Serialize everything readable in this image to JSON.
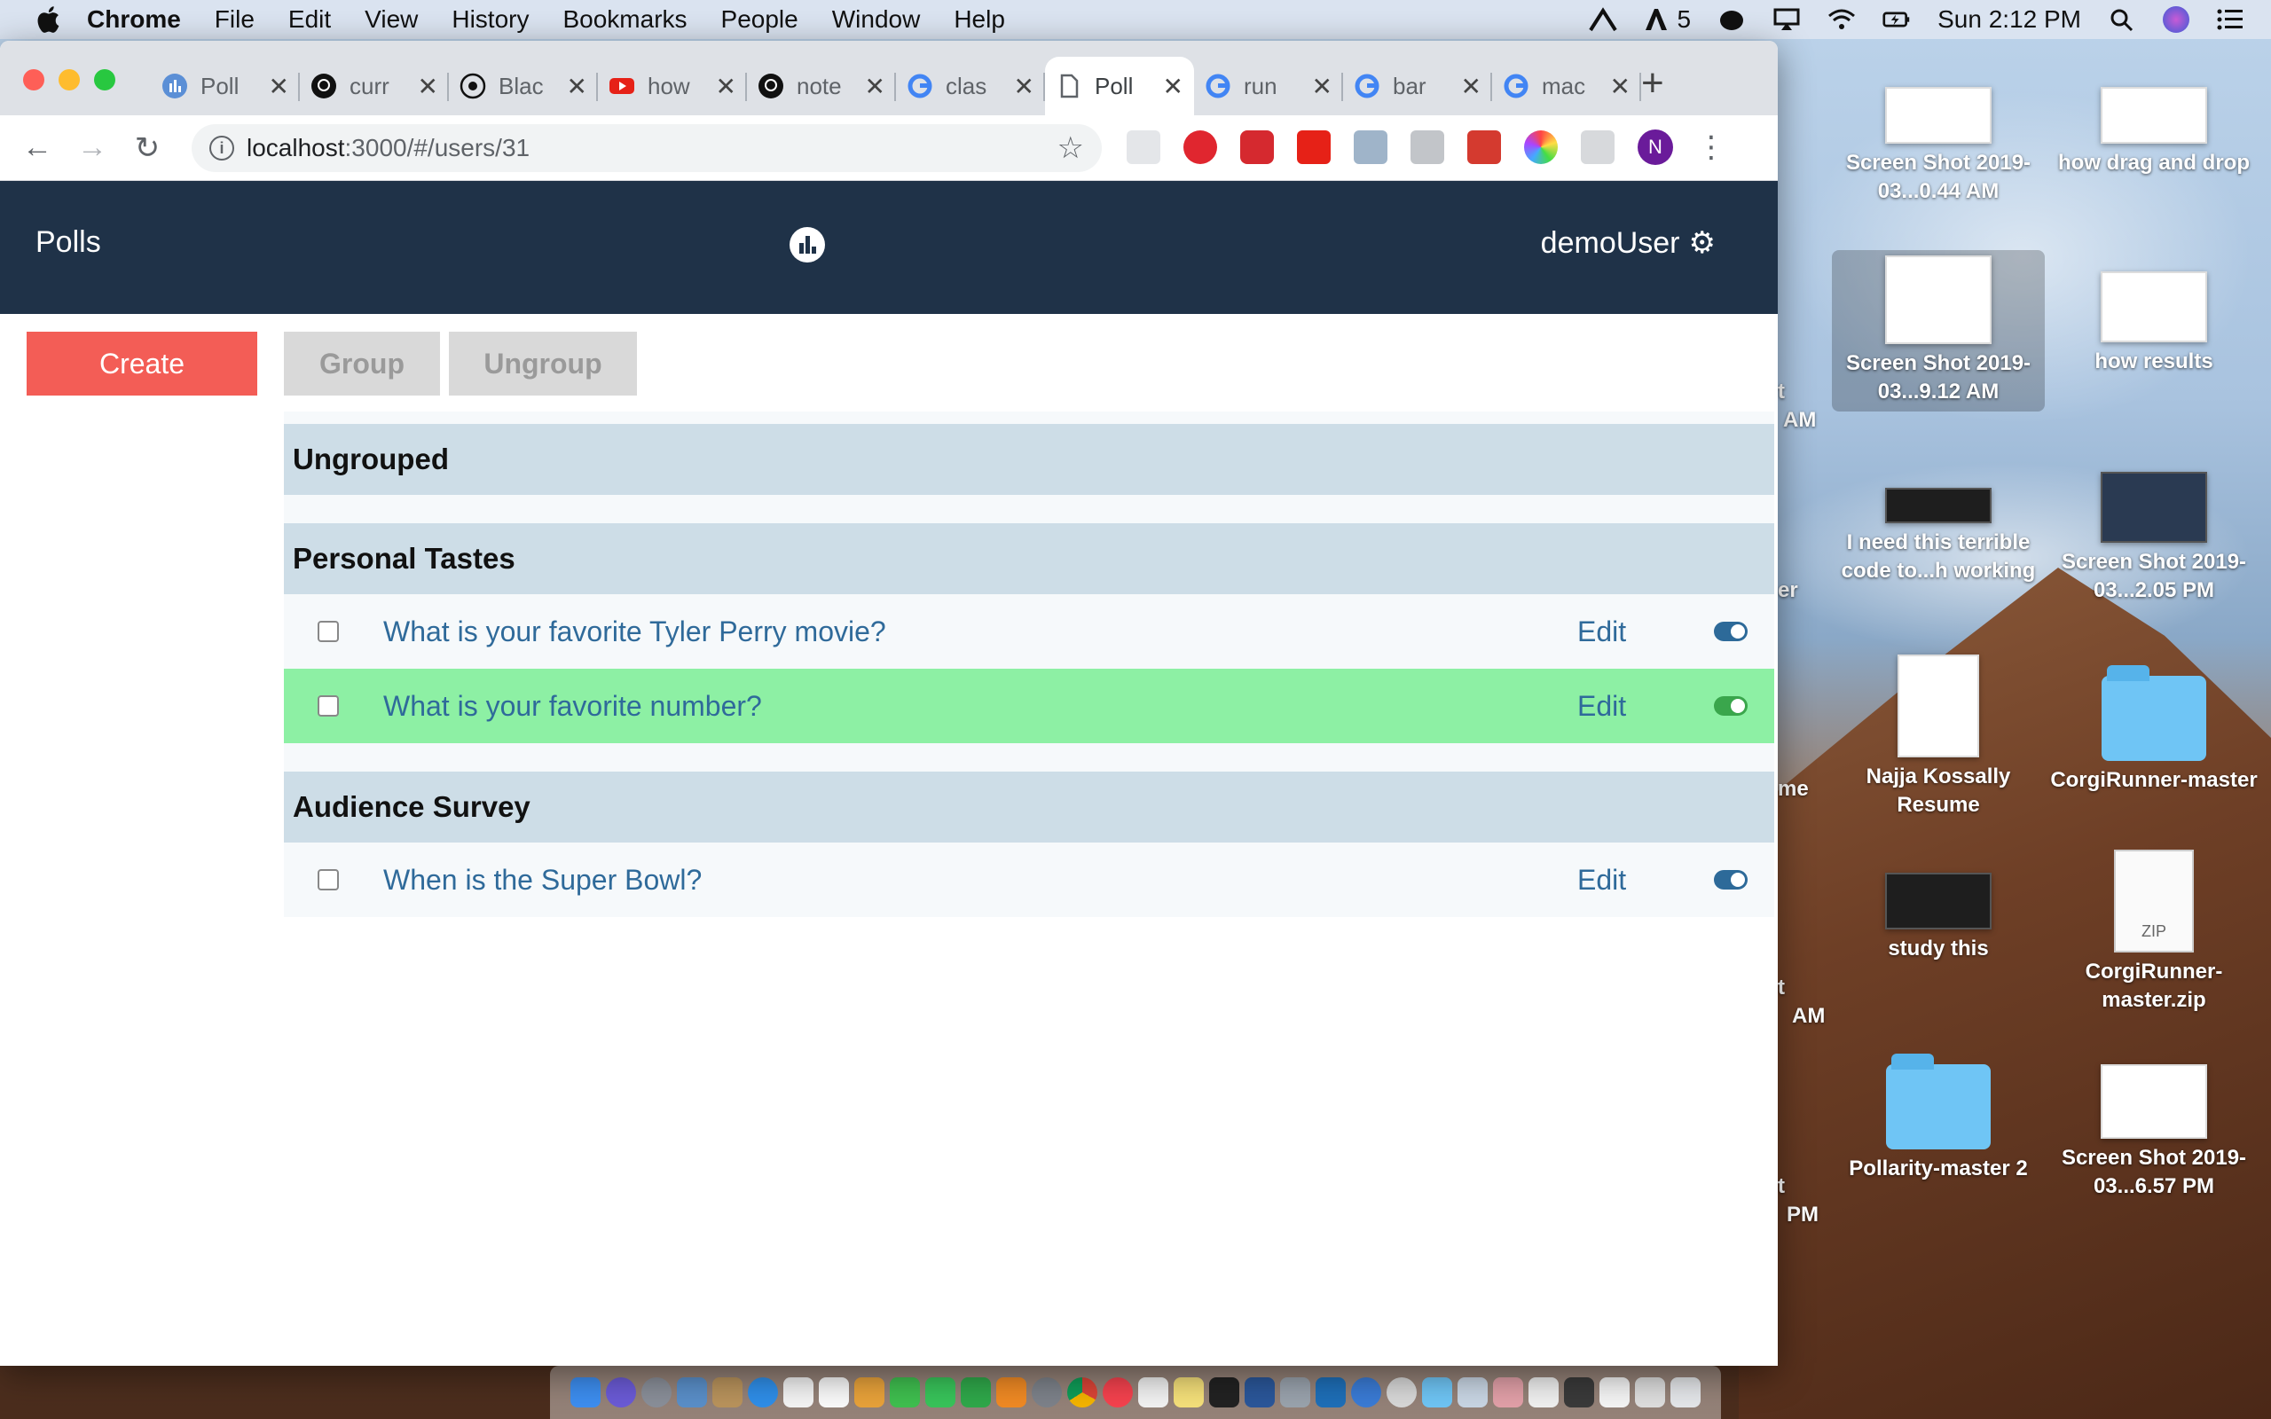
{
  "menubar": {
    "items": [
      "Chrome",
      "File",
      "Edit",
      "View",
      "History",
      "Bookmarks",
      "People",
      "Window",
      "Help"
    ],
    "status_count": "5",
    "clock": "Sun 2:12 PM"
  },
  "browser": {
    "tabs": [
      {
        "title": "Poll",
        "icon": "polls-favicon",
        "active": false
      },
      {
        "title": "curr",
        "icon": "github-icon",
        "active": false
      },
      {
        "title": "Blac",
        "icon": "eye-icon",
        "active": false
      },
      {
        "title": "how",
        "icon": "youtube-icon",
        "active": false
      },
      {
        "title": "note",
        "icon": "github-icon",
        "active": false
      },
      {
        "title": "clas",
        "icon": "google-icon",
        "active": false
      },
      {
        "title": "Poll",
        "icon": "document-icon",
        "active": true
      },
      {
        "title": "run",
        "icon": "google-icon",
        "active": false
      },
      {
        "title": "bar",
        "icon": "google-icon",
        "active": false
      },
      {
        "title": "mac",
        "icon": "google-icon",
        "active": false
      }
    ],
    "url_host": "localhost",
    "url_path": ":3000/#/users/31",
    "profile_initial": "N"
  },
  "app": {
    "title": "Polls",
    "username": "demoUser",
    "buttons": {
      "create": "Create",
      "group": "Group",
      "ungroup": "Ungroup"
    },
    "groups": [
      {
        "name": "Ungrouped",
        "polls": []
      },
      {
        "name": "Personal Tastes",
        "polls": [
          {
            "question": "What is your favorite Tyler Perry movie?",
            "edit": "Edit",
            "active": false
          },
          {
            "question": "What is your favorite number?",
            "edit": "Edit",
            "active": true
          }
        ]
      },
      {
        "name": "Audience Survey",
        "polls": [
          {
            "question": "When is the Super Bowl?",
            "edit": "Edit",
            "active": false
          }
        ]
      }
    ]
  },
  "desktop": {
    "items": [
      {
        "label": "Screen Shot 2019-03...0.44 AM",
        "kind": "screenshot"
      },
      {
        "label": "how drag and drop",
        "kind": "screenshot"
      },
      {
        "label": "Screen Shot 2019-03...9.12 AM",
        "kind": "screenshot"
      },
      {
        "label": "how results",
        "kind": "screenshot"
      },
      {
        "label": "I need this terrible code to...h working",
        "kind": "screenshot-dark"
      },
      {
        "label": "Screen Shot 2019-03...2.05 PM",
        "kind": "screenshot"
      },
      {
        "label": "Najja Kossally Resume",
        "kind": "document"
      },
      {
        "label": "CorgiRunner-master",
        "kind": "folder"
      },
      {
        "label": "study this",
        "kind": "screenshot-dark"
      },
      {
        "label": "CorgiRunner-master.zip",
        "kind": "zip"
      },
      {
        "label": "Pollarity-master 2",
        "kind": "folder"
      },
      {
        "label": "Screen Shot 2019-03...6.57 PM",
        "kind": "screenshot"
      }
    ],
    "zip_badge": "ZIP",
    "partial_labels": [
      "t",
      "AM",
      "er",
      "me",
      "t",
      "AM",
      "t",
      "PM"
    ]
  },
  "colors": {
    "header_bg": "#1f3248",
    "create_btn": "#f35d56",
    "active_row": "#8df0a4",
    "link": "#2f6a9a"
  }
}
